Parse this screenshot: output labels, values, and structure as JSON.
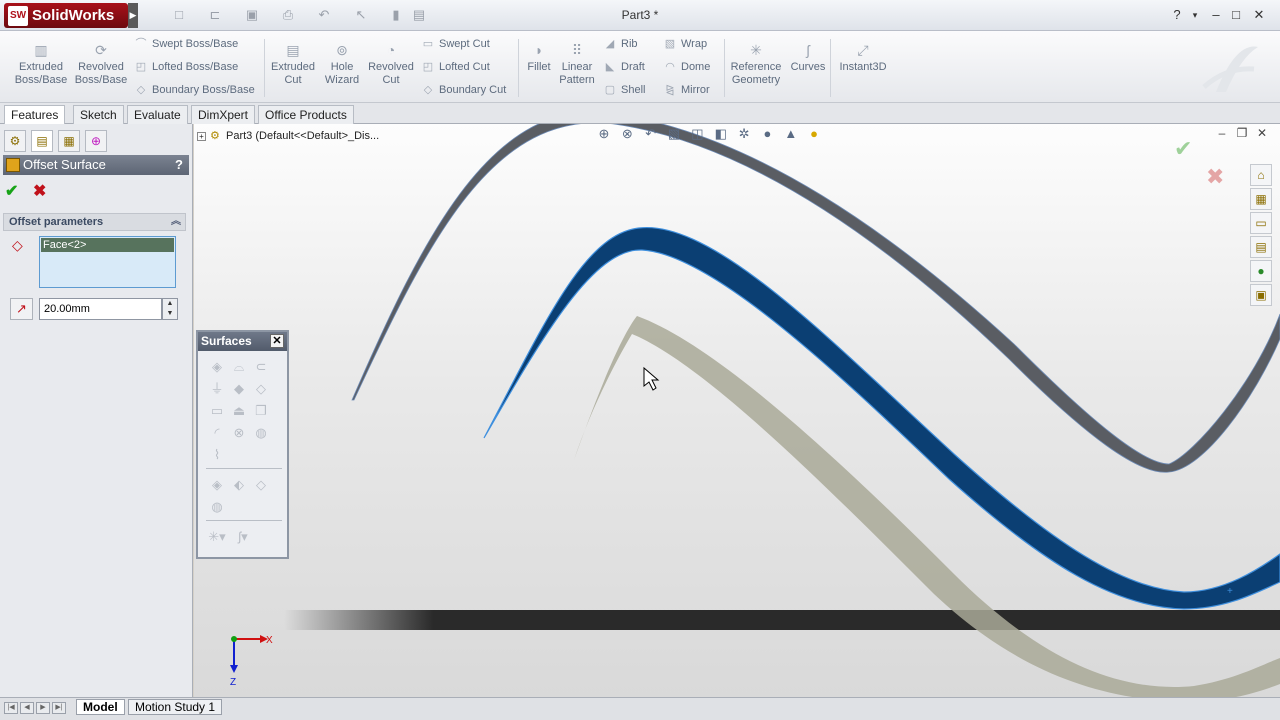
{
  "app": {
    "brand": "SolidWorks",
    "doc_title": "Part3 *"
  },
  "command_manager": {
    "extruded_boss": "Extruded\nBoss/Base",
    "revolved_boss": "Revolved\nBoss/Base",
    "swept_boss": "Swept Boss/Base",
    "lofted_boss": "Lofted Boss/Base",
    "boundary_boss": "Boundary Boss/Base",
    "extruded_cut": "Extruded\nCut",
    "hole_wizard": "Hole\nWizard",
    "revolved_cut": "Revolved\nCut",
    "swept_cut": "Swept Cut",
    "lofted_cut": "Lofted Cut",
    "boundary_cut": "Boundary Cut",
    "fillet": "Fillet",
    "linear_pattern": "Linear\nPattern",
    "rib": "Rib",
    "draft": "Draft",
    "shell": "Shell",
    "wrap": "Wrap",
    "dome": "Dome",
    "mirror": "Mirror",
    "reference_geometry": "Reference\nGeometry",
    "curves": "Curves",
    "instant3d": "Instant3D"
  },
  "tabs": [
    "Features",
    "Sketch",
    "Evaluate",
    "DimXpert",
    "Office Products"
  ],
  "active_tab": "Features",
  "property_manager": {
    "title": "Offset Surface",
    "help": "?",
    "group_title": "Offset parameters",
    "selected_face": "Face<2>",
    "distance_value": "20.00mm"
  },
  "tree": {
    "root_label": "Part3  (Default<<Default>_Dis..."
  },
  "surfaces_toolbar": {
    "title": "Surfaces"
  },
  "triad": {
    "x_label": "X",
    "z_label": "Z"
  },
  "bottom_tabs": [
    "Model",
    "Motion Study 1"
  ],
  "active_bottom_tab": "Model",
  "colors": {
    "selected_surface": "#0b3f73",
    "edge_highlight": "#3e8fde",
    "grey_surface": "#5a5d63",
    "offset_preview": "#a9a998"
  }
}
